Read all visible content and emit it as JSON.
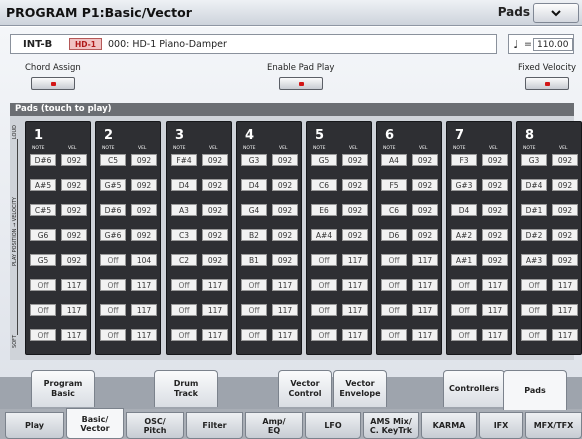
{
  "title": "PROGRAM P1:Basic/Vector",
  "page_menu": {
    "label": "Pads",
    "chevron": "chevron-down-icon"
  },
  "program": {
    "bank": "INT-B",
    "category": "HD-1",
    "name": "000: HD-1 Piano-Damper"
  },
  "tempo": {
    "symbol": "♩",
    "equals": "=",
    "value": "110.00"
  },
  "switches": {
    "chord_assign": "Chord Assign",
    "enable_pad_play": "Enable Pad Play",
    "fixed_velocity": "Fixed Velocity"
  },
  "pads_header": "Pads (touch to play)",
  "axis_labels": {
    "loud": "LOUD",
    "middle": "PLAY POSITION → VELOCITY",
    "soft": "SOFT"
  },
  "note_header": "NOTE",
  "vel_header": "VEL",
  "pads": [
    {
      "number": "1",
      "rows": [
        [
          "D#6",
          "092"
        ],
        [
          "A#5",
          "092"
        ],
        [
          "C#5",
          "092"
        ],
        [
          "G6",
          "092"
        ],
        [
          "G5",
          "092"
        ],
        [
          "Off",
          "117"
        ],
        [
          "Off",
          "117"
        ],
        [
          "Off",
          "117"
        ]
      ]
    },
    {
      "number": "2",
      "rows": [
        [
          "C5",
          "092"
        ],
        [
          "G#5",
          "092"
        ],
        [
          "D#6",
          "092"
        ],
        [
          "G#6",
          "092"
        ],
        [
          "Off",
          "104"
        ],
        [
          "Off",
          "117"
        ],
        [
          "Off",
          "117"
        ],
        [
          "Off",
          "117"
        ]
      ]
    },
    {
      "number": "3",
      "rows": [
        [
          "F#4",
          "092"
        ],
        [
          "D4",
          "092"
        ],
        [
          "A3",
          "092"
        ],
        [
          "C3",
          "092"
        ],
        [
          "C2",
          "092"
        ],
        [
          "Off",
          "117"
        ],
        [
          "Off",
          "117"
        ],
        [
          "Off",
          "117"
        ]
      ]
    },
    {
      "number": "4",
      "rows": [
        [
          "G3",
          "092"
        ],
        [
          "D4",
          "092"
        ],
        [
          "G4",
          "092"
        ],
        [
          "B2",
          "092"
        ],
        [
          "B1",
          "092"
        ],
        [
          "Off",
          "117"
        ],
        [
          "Off",
          "117"
        ],
        [
          "Off",
          "117"
        ]
      ]
    },
    {
      "number": "5",
      "rows": [
        [
          "G5",
          "092"
        ],
        [
          "C6",
          "092"
        ],
        [
          "E6",
          "092"
        ],
        [
          "A#4",
          "092"
        ],
        [
          "Off",
          "117"
        ],
        [
          "Off",
          "117"
        ],
        [
          "Off",
          "117"
        ],
        [
          "Off",
          "117"
        ]
      ]
    },
    {
      "number": "6",
      "rows": [
        [
          "A4",
          "092"
        ],
        [
          "F5",
          "092"
        ],
        [
          "C6",
          "092"
        ],
        [
          "D6",
          "092"
        ],
        [
          "Off",
          "117"
        ],
        [
          "Off",
          "117"
        ],
        [
          "Off",
          "117"
        ],
        [
          "Off",
          "117"
        ]
      ]
    },
    {
      "number": "7",
      "rows": [
        [
          "F3",
          "092"
        ],
        [
          "G#3",
          "092"
        ],
        [
          "D4",
          "092"
        ],
        [
          "A#2",
          "092"
        ],
        [
          "A#1",
          "092"
        ],
        [
          "Off",
          "117"
        ],
        [
          "Off",
          "117"
        ],
        [
          "Off",
          "117"
        ]
      ]
    },
    {
      "number": "8",
      "rows": [
        [
          "G3",
          "092"
        ],
        [
          "D#4",
          "092"
        ],
        [
          "D#1",
          "092"
        ],
        [
          "D#2",
          "092"
        ],
        [
          "A#3",
          "092"
        ],
        [
          "Off",
          "117"
        ],
        [
          "Off",
          "117"
        ],
        [
          "Off",
          "117"
        ]
      ]
    }
  ],
  "top_tabs": [
    {
      "label": "Program\nBasic",
      "active": false
    },
    {
      "label": "Drum\nTrack",
      "active": false
    },
    {
      "label": "Vector\nControl",
      "active": false
    },
    {
      "label": "Vector\nEnvelope",
      "active": false
    },
    {
      "label": "Controllers",
      "active": false
    },
    {
      "label": "Pads",
      "active": true
    }
  ],
  "bottom_tabs": [
    {
      "label": "Play",
      "active": false
    },
    {
      "label": "Basic/\nVector",
      "active": true
    },
    {
      "label": "OSC/\nPitch",
      "active": false
    },
    {
      "label": "Filter",
      "active": false
    },
    {
      "label": "Amp/\nEQ",
      "active": false
    },
    {
      "label": "LFO",
      "active": false
    },
    {
      "label": "AMS Mix/\nC. KeyTrk",
      "active": false
    },
    {
      "label": "KARMA",
      "active": false
    },
    {
      "label": "IFX",
      "active": false
    },
    {
      "label": "MFX/TFX",
      "active": false
    }
  ],
  "colors": {
    "accent_led": "#d21616",
    "pad_bg": "#2e2f33",
    "category_bg": "#f1c2c2"
  }
}
